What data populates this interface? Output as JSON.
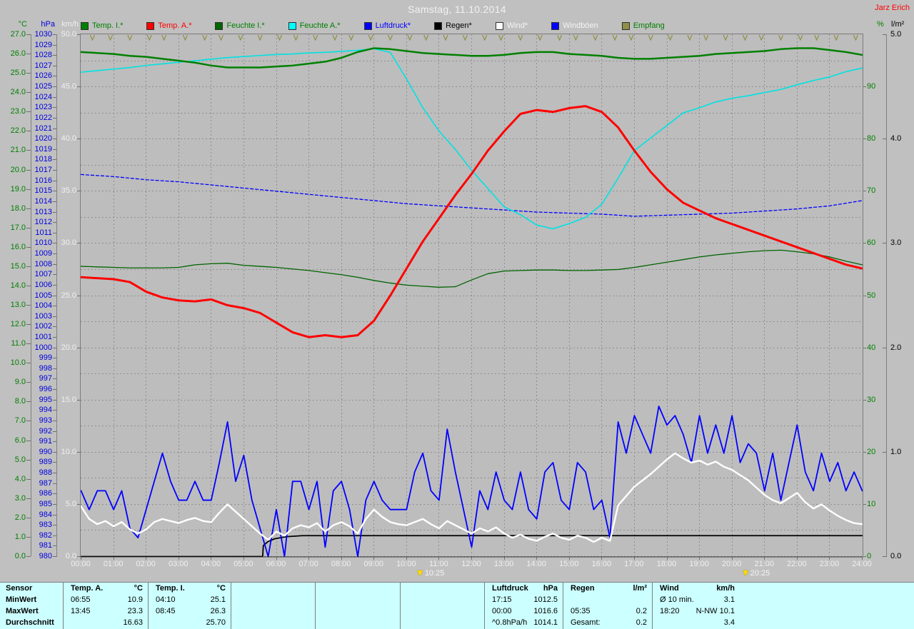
{
  "header": {
    "title": "Samstag, 11.10.2014",
    "station": "Jarz Erich"
  },
  "legend": {
    "items": [
      {
        "label": "Temp. I.*",
        "swatch": "#008000",
        "text_color": "#008000"
      },
      {
        "label": "Temp. A.*",
        "swatch": "#ff0000",
        "text_color": "#ff0000"
      },
      {
        "label": "Feuchte I.*",
        "swatch": "#006400",
        "text_color": "#008000"
      },
      {
        "label": "Feuchte A.*",
        "swatch": "#00ffff",
        "text_color": "#008000"
      },
      {
        "label": "Luftdruck*",
        "swatch": "#0000ff",
        "text_color": "#0000ff"
      },
      {
        "label": "Regen*",
        "swatch": "#000000",
        "text_color": "#000000"
      },
      {
        "label": "Wind*",
        "swatch": "#ffffff",
        "text_color": "#f5f5f5"
      },
      {
        "label": "Windböen",
        "swatch": "#0000ff",
        "text_color": "#f5f5f5"
      },
      {
        "label": "Empfang",
        "swatch": "#8f8f46",
        "text_color": "#008000"
      }
    ]
  },
  "axes": {
    "left_headers": [
      "°C",
      "hPa",
      "km/h"
    ],
    "right_headers": [
      "%",
      "l/m²"
    ],
    "celsius_ticks": [
      "27.0",
      "26.0",
      "25.0",
      "24.0",
      "23.0",
      "22.0",
      "21.0",
      "20.0",
      "19.0",
      "18.0",
      "17.0",
      "16.0",
      "15.0",
      "14.0",
      "13.0",
      "12.0",
      "11.0",
      "10.0",
      "9.0",
      "8.0",
      "7.0",
      "6.0",
      "5.0",
      "4.0",
      "3.0",
      "2.0",
      "1.0",
      "0.0"
    ],
    "hpa_ticks": [
      "1030",
      "1029",
      "1028",
      "1027",
      "1026",
      "1025",
      "1024",
      "1023",
      "1022",
      "1021",
      "1020",
      "1019",
      "1018",
      "1017",
      "1016",
      "1015",
      "1014",
      "1013",
      "1012",
      "1011",
      "1010",
      "1009",
      "1008",
      "1007",
      "1006",
      "1005",
      "1004",
      "1003",
      "1002",
      "1001",
      "1000",
      "999",
      "998",
      "997",
      "996",
      "995",
      "994",
      "993",
      "992",
      "991",
      "990",
      "989",
      "988",
      "987",
      "986",
      "985",
      "984",
      "983",
      "982",
      "981",
      "980"
    ],
    "kmh_ticks": [
      "50.0",
      "45.0",
      "40.0",
      "35.0",
      "30.0",
      "25.0",
      "20.0",
      "15.0",
      "10.0",
      "5.0",
      "0.0"
    ],
    "percent_ticks": [
      "90",
      "80",
      "70",
      "60",
      "50",
      "40",
      "30",
      "20",
      "10",
      "0"
    ],
    "lm2_ticks": [
      "5.0",
      "4.0",
      "3.0",
      "2.0",
      "1.0",
      "0.0"
    ],
    "time_ticks": [
      "00:00",
      "01:00",
      "02:00",
      "03:00",
      "04:00",
      "05:00",
      "06:00",
      "07:00",
      "08:00",
      "09:00",
      "10:00",
      "11:00",
      "12:00",
      "13:00",
      "14:00",
      "15:00",
      "16:00",
      "17:00",
      "18:00",
      "19:00",
      "20:00",
      "21:00",
      "22:00",
      "23:00",
      "24:00"
    ],
    "colors": {
      "celsius": "#008000",
      "hpa": "#0000e0",
      "kmh": "#f0f0f0",
      "percent": "#008000",
      "lm2": "#000000",
      "time": "#f0f0f0"
    }
  },
  "time_markers": [
    {
      "label": "10:25",
      "hour": 10.4167
    },
    {
      "label": "20:25",
      "hour": 20.4167
    }
  ],
  "chart_data": {
    "type": "line",
    "x_unit": "hours",
    "x_range": [
      0,
      24
    ],
    "grid": {
      "on": true,
      "v_step_h": 1,
      "h_divisions": 20,
      "color": "#8f8f8f"
    },
    "series": [
      {
        "name": "Luftdruck",
        "axis": "hPa",
        "axis_range": [
          980,
          1030
        ],
        "color": "#0000ff",
        "width": 1.3,
        "dash": "4 3",
        "x_step_h": 1,
        "values": [
          1016.6,
          1016.4,
          1016.1,
          1015.9,
          1015.6,
          1015.3,
          1015.0,
          1014.7,
          1014.4,
          1014.1,
          1013.8,
          1013.6,
          1013.4,
          1013.2,
          1013.0,
          1012.9,
          1012.8,
          1012.6,
          1012.7,
          1012.8,
          1012.9,
          1013.1,
          1013.3,
          1013.6,
          1014.1
        ]
      },
      {
        "name": "Feuchte A.",
        "axis": "%",
        "axis_range": [
          0,
          100
        ],
        "color": "#00e2e2",
        "width": 1.6,
        "x_step_h": 0.5,
        "values": [
          92.8,
          93.1,
          93.4,
          93.7,
          94.1,
          94.4,
          94.7,
          95.0,
          95.3,
          95.6,
          95.8,
          96.0,
          96.2,
          96.3,
          96.5,
          96.6,
          96.8,
          97.0,
          97.3,
          96.6,
          91.5,
          86.0,
          81.5,
          78.0,
          74.0,
          70.5,
          67.0,
          65.5,
          63.5,
          62.8,
          63.8,
          65.0,
          67.5,
          72.5,
          77.8,
          80.2,
          82.6,
          85.0,
          86.0,
          87.1,
          87.8,
          88.3,
          88.9,
          89.5,
          90.4,
          91.2,
          91.9,
          92.9,
          93.6
        ]
      },
      {
        "name": "Temp. I.",
        "axis": "°C",
        "axis_range": [
          0,
          27
        ],
        "color": "#008000",
        "width": 2.5,
        "x_step_h": 0.5,
        "values": [
          26.1,
          26.05,
          26.0,
          25.9,
          25.85,
          25.75,
          25.65,
          25.55,
          25.4,
          25.3,
          25.3,
          25.3,
          25.35,
          25.4,
          25.5,
          25.6,
          25.8,
          26.1,
          26.3,
          26.25,
          26.15,
          26.05,
          26.0,
          25.95,
          25.9,
          25.9,
          25.95,
          26.05,
          26.1,
          26.1,
          26.0,
          25.95,
          25.9,
          25.8,
          25.75,
          25.75,
          25.8,
          25.85,
          25.9,
          26.0,
          26.05,
          26.1,
          26.15,
          26.25,
          26.3,
          26.3,
          26.2,
          26.1,
          25.95
        ]
      },
      {
        "name": "Feuchte I.",
        "axis": "%",
        "axis_range": [
          0,
          100
        ],
        "color": "#006400",
        "width": 1.3,
        "x_step_h": 0.5,
        "values": [
          55.6,
          55.5,
          55.4,
          55.3,
          55.3,
          55.3,
          55.4,
          55.9,
          56.1,
          56.2,
          55.8,
          55.6,
          55.4,
          55.1,
          54.8,
          54.4,
          54.0,
          53.5,
          52.9,
          52.4,
          52.0,
          51.8,
          51.6,
          51.7,
          53.0,
          54.2,
          54.7,
          54.8,
          54.9,
          54.9,
          54.8,
          54.8,
          54.9,
          55.0,
          55.4,
          55.9,
          56.4,
          56.9,
          57.4,
          57.8,
          58.1,
          58.4,
          58.6,
          58.7,
          58.4,
          58.0,
          57.4,
          56.6,
          55.9
        ]
      },
      {
        "name": "Regen",
        "axis": "l/m²",
        "axis_range": [
          0,
          5
        ],
        "color": "#000000",
        "width": 1.8,
        "points": [
          [
            0,
            0
          ],
          [
            5.58,
            0
          ],
          [
            5.6,
            0.105
          ],
          [
            5.75,
            0.145
          ],
          [
            5.95,
            0.17
          ],
          [
            6.3,
            0.19
          ],
          [
            6.8,
            0.2
          ],
          [
            24,
            0.2
          ]
        ]
      },
      {
        "name": "Windböen",
        "axis": "km/h",
        "axis_range": [
          0,
          50
        ],
        "color": "#0000ff",
        "width": 1.8,
        "x_step_h": 0.25,
        "values": [
          6.3,
          4.5,
          6.3,
          6.3,
          4.5,
          6.3,
          2.7,
          1.8,
          4.5,
          7.2,
          9.9,
          7.2,
          5.4,
          5.4,
          7.2,
          5.4,
          5.4,
          9.0,
          12.9,
          7.2,
          9.7,
          5.4,
          2.7,
          0.0,
          4.5,
          0.0,
          7.2,
          7.2,
          4.5,
          7.2,
          0.9,
          6.3,
          7.2,
          4.5,
          0.0,
          5.4,
          7.2,
          5.4,
          4.5,
          4.5,
          4.5,
          8.1,
          9.9,
          6.3,
          5.4,
          12.2,
          8.1,
          4.5,
          0.9,
          6.3,
          4.5,
          8.1,
          5.4,
          4.5,
          8.1,
          4.5,
          3.6,
          8.1,
          9.0,
          5.4,
          4.5,
          9.0,
          8.1,
          4.5,
          5.4,
          1.8,
          12.9,
          9.9,
          13.5,
          11.7,
          9.9,
          14.4,
          12.6,
          13.5,
          11.7,
          9.0,
          13.5,
          9.9,
          12.6,
          9.9,
          13.5,
          9.0,
          10.8,
          9.9,
          6.3,
          9.9,
          5.4,
          9.0,
          12.6,
          8.1,
          6.3,
          9.9,
          7.2,
          9.0,
          6.3,
          8.1,
          6.3
        ]
      },
      {
        "name": "Wind",
        "axis": "km/h",
        "axis_range": [
          0,
          50
        ],
        "color": "#ffffff",
        "width": 2.4,
        "x_step_h": 0.25,
        "values": [
          4.8,
          3.6,
          3.1,
          3.4,
          2.9,
          3.3,
          2.6,
          2.2,
          2.6,
          3.3,
          3.6,
          3.4,
          3.2,
          3.5,
          3.7,
          3.4,
          3.3,
          4.2,
          5.0,
          4.3,
          3.6,
          2.9,
          2.2,
          1.6,
          2.4,
          2.0,
          2.7,
          3.0,
          2.8,
          3.2,
          2.4,
          3.0,
          3.3,
          2.9,
          2.2,
          3.6,
          4.5,
          3.8,
          3.3,
          3.1,
          3.0,
          3.3,
          3.6,
          3.1,
          2.7,
          3.4,
          3.0,
          2.6,
          2.2,
          2.7,
          2.4,
          2.8,
          2.2,
          1.8,
          2.1,
          1.7,
          1.5,
          1.9,
          2.2,
          1.8,
          1.6,
          2.0,
          1.8,
          1.4,
          1.8,
          1.5,
          4.9,
          5.8,
          6.7,
          7.3,
          7.9,
          8.6,
          9.3,
          9.9,
          9.4,
          9.0,
          9.2,
          8.8,
          9.1,
          8.6,
          8.3,
          7.8,
          7.3,
          6.6,
          5.9,
          5.4,
          5.1,
          5.6,
          6.1,
          5.2,
          4.6,
          5.0,
          4.4,
          3.9,
          3.5,
          3.2,
          3.1
        ]
      },
      {
        "name": "Temp. A.",
        "axis": "°C",
        "axis_range": [
          0,
          27
        ],
        "color": "#ff0000",
        "width": 3,
        "x_step_h": 0.5,
        "values": [
          14.45,
          14.4,
          14.35,
          14.2,
          13.7,
          13.4,
          13.25,
          13.2,
          13.3,
          13.0,
          12.85,
          12.6,
          12.1,
          11.6,
          11.35,
          11.45,
          11.35,
          11.45,
          12.2,
          13.5,
          14.9,
          16.3,
          17.5,
          18.7,
          19.8,
          21.0,
          22.0,
          22.9,
          23.1,
          23.0,
          23.2,
          23.3,
          23.0,
          22.2,
          21.0,
          19.9,
          19.0,
          18.3,
          17.9,
          17.5,
          17.2,
          16.9,
          16.6,
          16.3,
          16.0,
          15.7,
          15.4,
          15.1,
          14.9
        ]
      },
      {
        "name": "Empfang",
        "marker": "tick",
        "color": "#8f8f46",
        "times": [
          0.35,
          0.9,
          1.5,
          2.1,
          2.55,
          3.2,
          3.8,
          4.3,
          4.9,
          5.5,
          6.1,
          6.6,
          7.2,
          7.8,
          8.3,
          8.9,
          9.5,
          10.1,
          10.6,
          11.2,
          11.8,
          12.4,
          12.9,
          13.5,
          14.1,
          14.7,
          15.2,
          15.8,
          16.4,
          16.9,
          17.5,
          18.1,
          18.7,
          19.2,
          19.8,
          20.4,
          20.9,
          21.5,
          22.1,
          22.6,
          23.2,
          23.8
        ]
      }
    ]
  },
  "table": {
    "row_headers": [
      "Sensor",
      "MinWert",
      "MaxWert",
      "Durchschnitt"
    ],
    "columns": [
      {
        "name": "Temp. A.",
        "unit": "°C",
        "rows": [
          [
            "06:55",
            "10.9"
          ],
          [
            "13:45",
            "23.3"
          ],
          [
            "",
            "16.63"
          ]
        ]
      },
      {
        "name": "Temp. I.",
        "unit": "°C",
        "rows": [
          [
            "04:10",
            "25.1"
          ],
          [
            "08:45",
            "26.3"
          ],
          [
            "",
            "25.70"
          ]
        ]
      },
      {
        "name": "",
        "unit": "",
        "rows": [
          [
            "",
            ""
          ],
          [
            "",
            ""
          ],
          [
            "",
            ""
          ]
        ]
      },
      {
        "name": "",
        "unit": "",
        "rows": [
          [
            "",
            ""
          ],
          [
            "",
            ""
          ],
          [
            "",
            ""
          ]
        ]
      },
      {
        "name": "",
        "unit": "",
        "rows": [
          [
            "",
            ""
          ],
          [
            "",
            ""
          ],
          [
            "",
            ""
          ]
        ]
      },
      {
        "name": "Luftdruck",
        "unit": "hPa",
        "rows": [
          [
            "17:15",
            "1012.5"
          ],
          [
            "00:00",
            "1016.6"
          ],
          [
            "^0.8hPa/h",
            "1014.1"
          ]
        ]
      },
      {
        "name": "Regen",
        "unit": "l/m²",
        "rows": [
          [
            "",
            ""
          ],
          [
            "05:35",
            "0.2"
          ],
          [
            "Gesamt:",
            "0.2"
          ]
        ]
      },
      {
        "name": "Wind",
        "unit": "km/h",
        "rows": [
          [
            "Ø 10 min.",
            "3.1"
          ],
          [
            "18:20",
            "N-NW 10.1"
          ],
          [
            "",
            "3.4"
          ]
        ]
      }
    ]
  }
}
